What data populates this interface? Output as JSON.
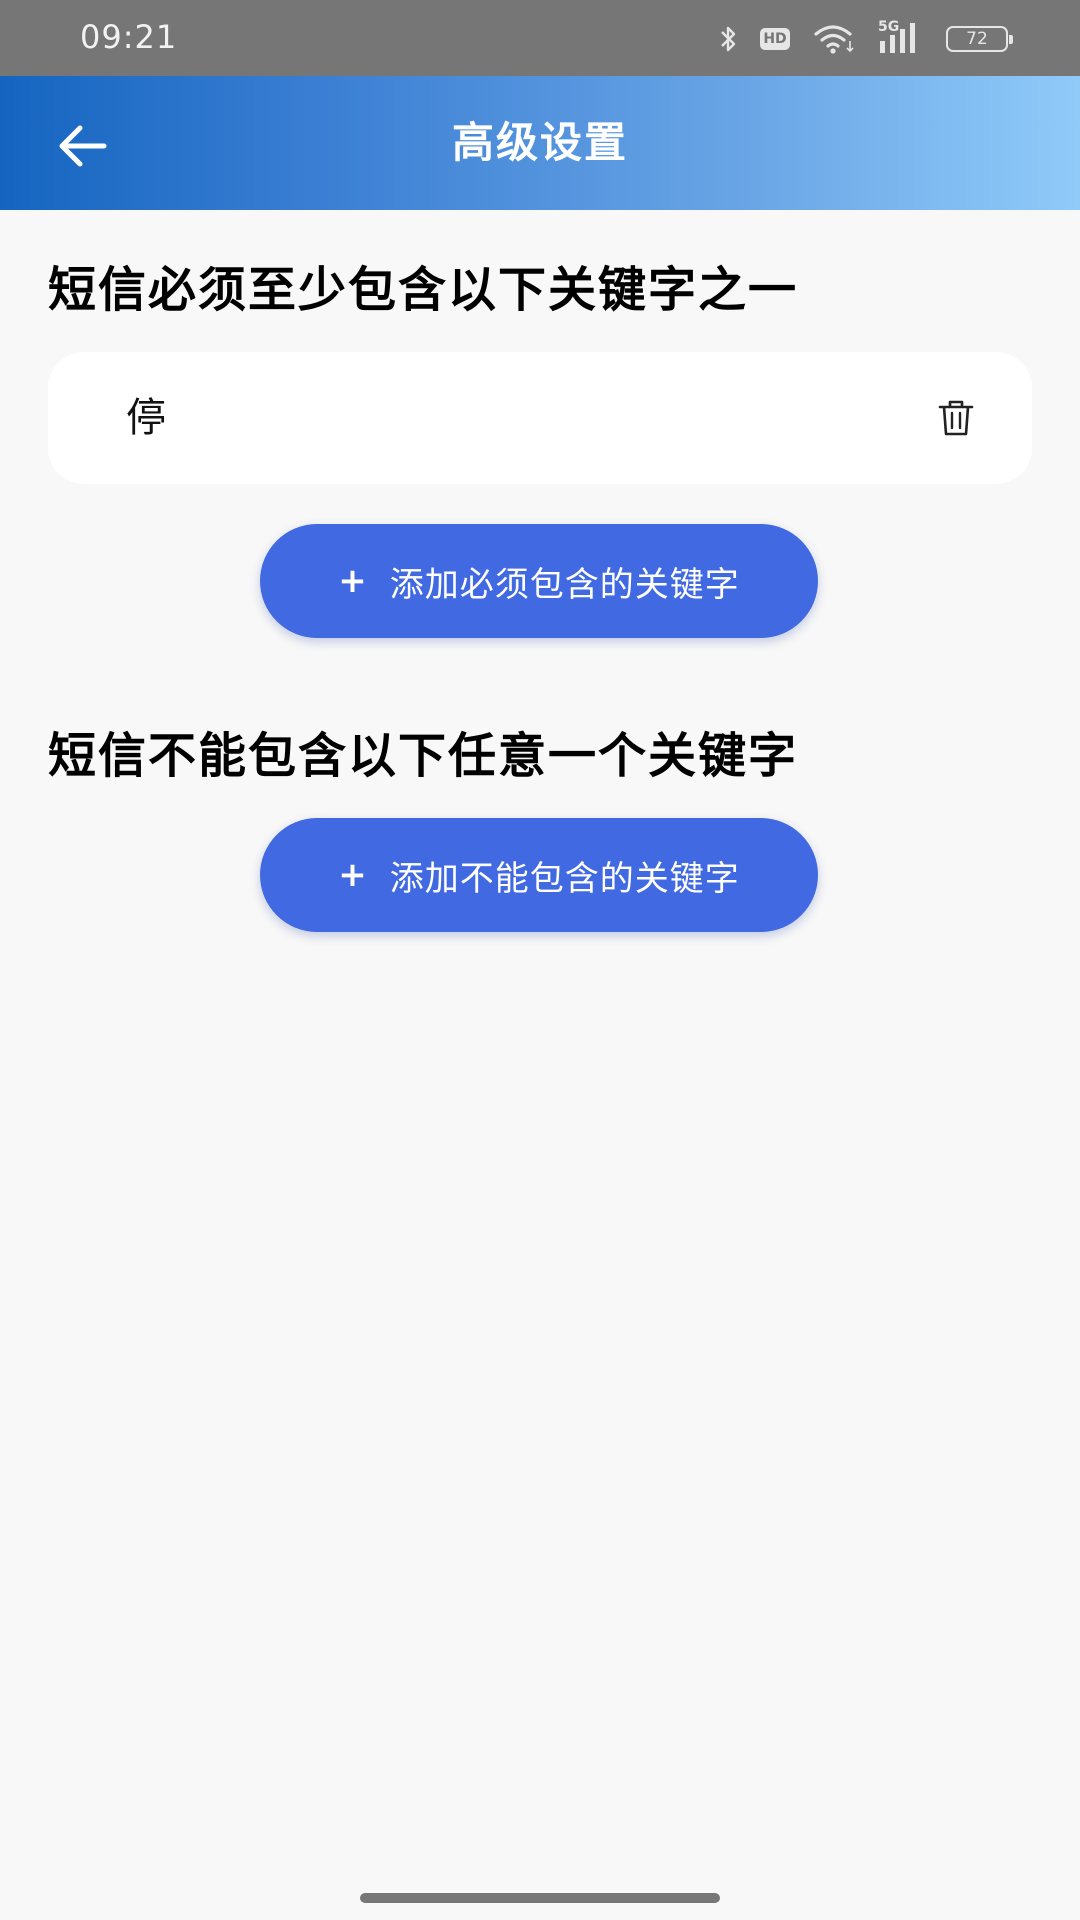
{
  "status_bar": {
    "time": "09:21",
    "hd_label": "HD",
    "network_label": "5G",
    "battery": "72",
    "icons": [
      "bluetooth-icon",
      "hd-icon",
      "wifi-icon",
      "cellular-signal-icon",
      "battery-icon"
    ]
  },
  "app_bar": {
    "title": "高级设置",
    "back_icon": "arrow-left-icon"
  },
  "must_contain": {
    "title": "短信必须至少包含以下关键字之一",
    "keywords": [
      {
        "text": "停",
        "delete_icon": "trash-icon"
      }
    ],
    "add_button_icon": "+",
    "add_button_label": "添加必须包含的关键字"
  },
  "must_not_contain": {
    "title": "短信不能包含以下任意一个关键字",
    "keywords": [],
    "add_button_icon": "+",
    "add_button_label": "添加不能包含的关键字"
  },
  "colors": {
    "app_bar_start": "#1565c0",
    "app_bar_end": "#90caf9",
    "button": "#4169e1",
    "background": "#f8f8f8"
  }
}
